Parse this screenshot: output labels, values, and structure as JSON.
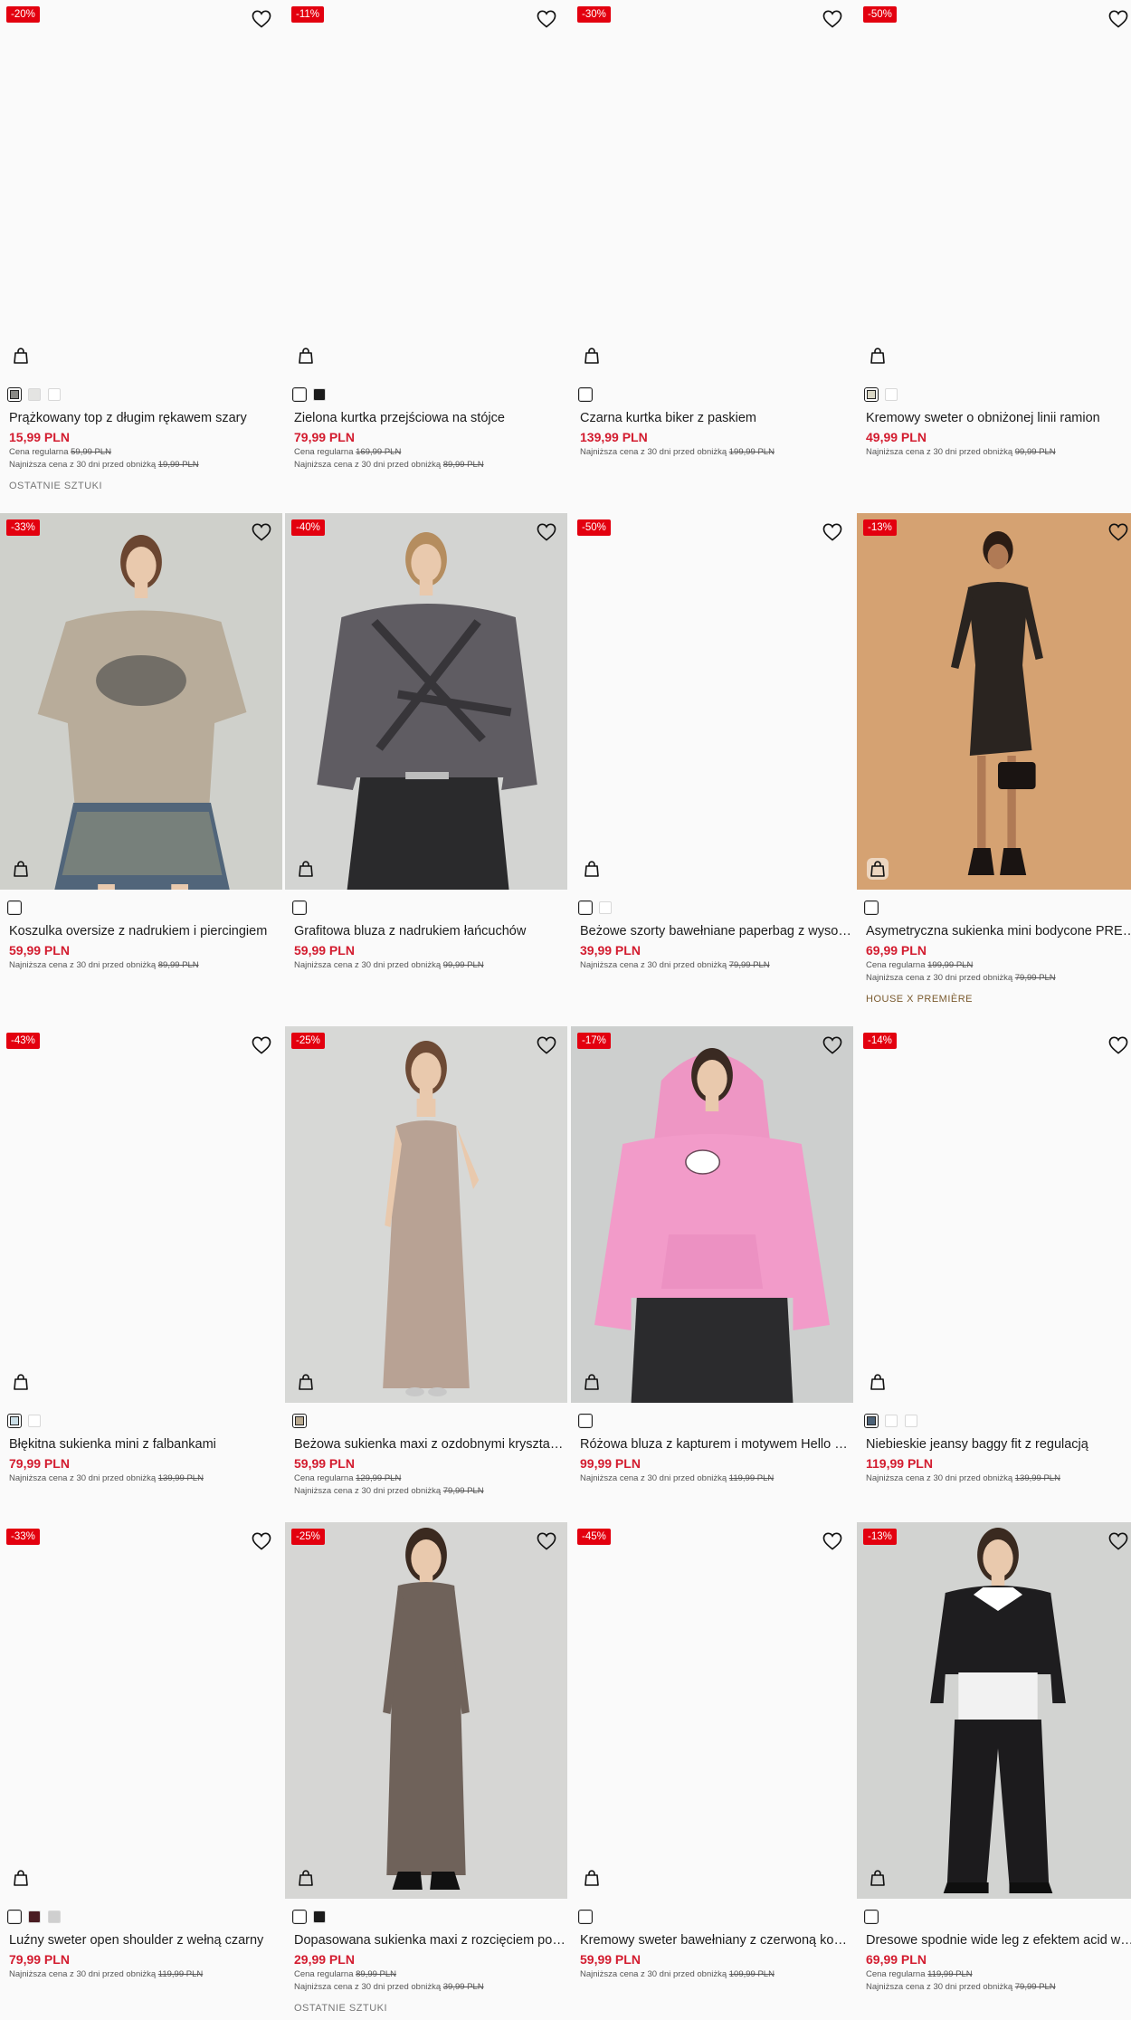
{
  "icons": {
    "wishlist": "heart-outline-icon",
    "cart": "shopping-bag-icon"
  },
  "colors": {
    "badge": "#e3000f",
    "sale_price": "#d31c2f",
    "page_bg": "#fafafa"
  },
  "products": [
    {
      "badge": "-20%",
      "name": "Prążkowany top z długim rękawem szary",
      "price": "15,99 PLN",
      "regular_label": "Cena regularna",
      "regular_price": "59,99 PLN",
      "lowest_label": "Najniższa cena z 30 dni przed obniżką",
      "lowest_price": "19,99 PLN",
      "tag": "OSTATNIE SZTUKI",
      "swatches": [
        "#8a8a86",
        "#e4e4e2",
        "#ffffff"
      ]
    },
    {
      "badge": "-11%",
      "name": "Zielona kurtka przejściowa na stójce",
      "price": "79,99 PLN",
      "regular_label": "Cena regularna",
      "regular_price": "169,99 PLN",
      "lowest_label": "Najniższa cena z 30 dni przed obniżką",
      "lowest_price": "89,99 PLN",
      "swatches": [
        "#ffffff",
        "#1b1b1b"
      ]
    },
    {
      "badge": "-30%",
      "name": "Czarna kurtka biker z paskiem",
      "price": "139,99 PLN",
      "lowest_label": "Najniższa cena z 30 dni przed obniżką",
      "lowest_price": "199,99 PLN",
      "swatches": [
        "#ffffff"
      ]
    },
    {
      "badge": "-50%",
      "name": "Kremowy sweter o obniżonej linii ramion",
      "price": "49,99 PLN",
      "lowest_label": "Najniższa cena z 30 dni przed obniżką",
      "lowest_price": "99,99 PLN",
      "swatches": [
        "#d9d6c4",
        "#ffffff"
      ]
    },
    {
      "badge": "-33%",
      "name": "Koszulka oversize z nadrukiem i piercingiem",
      "price": "59,99 PLN",
      "lowest_label": "Najniższa cena z 30 dni przed obniżką",
      "lowest_price": "89,99 PLN",
      "swatches": [
        "#ffffff"
      ]
    },
    {
      "badge": "-40%",
      "name": "Grafitowa bluza z nadrukiem łańcuchów",
      "price": "59,99 PLN",
      "lowest_label": "Najniższa cena z 30 dni przed obniżką",
      "lowest_price": "99,99 PLN",
      "swatches": [
        "#ffffff"
      ]
    },
    {
      "badge": "-50%",
      "name": "Beżowe szorty bawełniane paperbag z wysokim stanem",
      "price": "39,99 PLN",
      "lowest_label": "Najniższa cena z 30 dni przed obniżką",
      "lowest_price": "79,99 PLN",
      "swatches": [
        "#ffffff",
        "#ffffff"
      ]
    },
    {
      "badge": "-13%",
      "name": "Asymetryczna sukienka mini bodycone PREMIÈRE",
      "price": "69,99 PLN",
      "regular_label": "Cena regularna",
      "regular_price": "199,99 PLN",
      "lowest_label": "Najniższa cena z 30 dni przed obniżką",
      "lowest_price": "79,99 PLN",
      "tag": "HOUSE X PREMIÈRE",
      "swatches": [
        "#ffffff"
      ]
    },
    {
      "badge": "-43%",
      "name": "Błękitna sukienka mini z falbankami",
      "price": "79,99 PLN",
      "lowest_label": "Najniższa cena z 30 dni przed obniżką",
      "lowest_price": "139,99 PLN",
      "swatches": [
        "#c9dde6",
        "#ffffff"
      ]
    },
    {
      "badge": "-25%",
      "name": "Beżowa sukienka maxi z ozdobnymi kryształkami",
      "price": "59,99 PLN",
      "regular_label": "Cena regularna",
      "regular_price": "129,99 PLN",
      "lowest_label": "Najniższa cena z 30 dni przed obniżką",
      "lowest_price": "79,99 PLN",
      "swatches": [
        "#b9a98f"
      ]
    },
    {
      "badge": "-17%",
      "name": "Różowa bluza z kapturem i motywem Hello Kitty",
      "price": "99,99 PLN",
      "lowest_label": "Najniższa cena z 30 dni przed obniżką",
      "lowest_price": "119,99 PLN",
      "swatches": [
        "#ffffff"
      ]
    },
    {
      "badge": "-14%",
      "name": "Niebieskie jeansy baggy fit z regulacją",
      "price": "119,99 PLN",
      "lowest_label": "Najniższa cena z 30 dni przed obniżką",
      "lowest_price": "139,99 PLN",
      "swatches": [
        "#4c6278",
        "#ffffff",
        "#ffffff"
      ]
    },
    {
      "badge": "-33%",
      "name": "Luźny sweter open shoulder z wełną czarny",
      "price": "79,99 PLN",
      "lowest_label": "Najniższa cena z 30 dni przed obniżką",
      "lowest_price": "119,99 PLN",
      "swatches": [
        "#ffffff",
        "#4a1c22",
        "#cfcfcf"
      ]
    },
    {
      "badge": "-25%",
      "name": "Dopasowana sukienka maxi z rozcięciem po boku",
      "price": "29,99 PLN",
      "regular_label": "Cena regularna",
      "regular_price": "89,99 PLN",
      "lowest_label": "Najniższa cena z 30 dni przed obniżką",
      "lowest_price": "39,99 PLN",
      "tag": "OSTATNIE SZTUKI",
      "swatches": [
        "#ffffff",
        "#1b1b1b"
      ]
    },
    {
      "badge": "-45%",
      "name": "Kremowy sweter bawełniany z czerwoną kokardą",
      "price": "59,99 PLN",
      "lowest_label": "Najniższa cena z 30 dni przed obniżką",
      "lowest_price": "109,99 PLN",
      "swatches": [
        "#ffffff"
      ]
    },
    {
      "badge": "-13%",
      "name": "Dresowe spodnie wide leg z efektem acid wash",
      "price": "69,99 PLN",
      "regular_label": "Cena regularna",
      "regular_price": "119,99 PLN",
      "lowest_label": "Najniższa cena z 30 dni przed obniżką",
      "lowest_price": "79,99 PLN",
      "swatches": [
        "#ffffff"
      ]
    }
  ]
}
